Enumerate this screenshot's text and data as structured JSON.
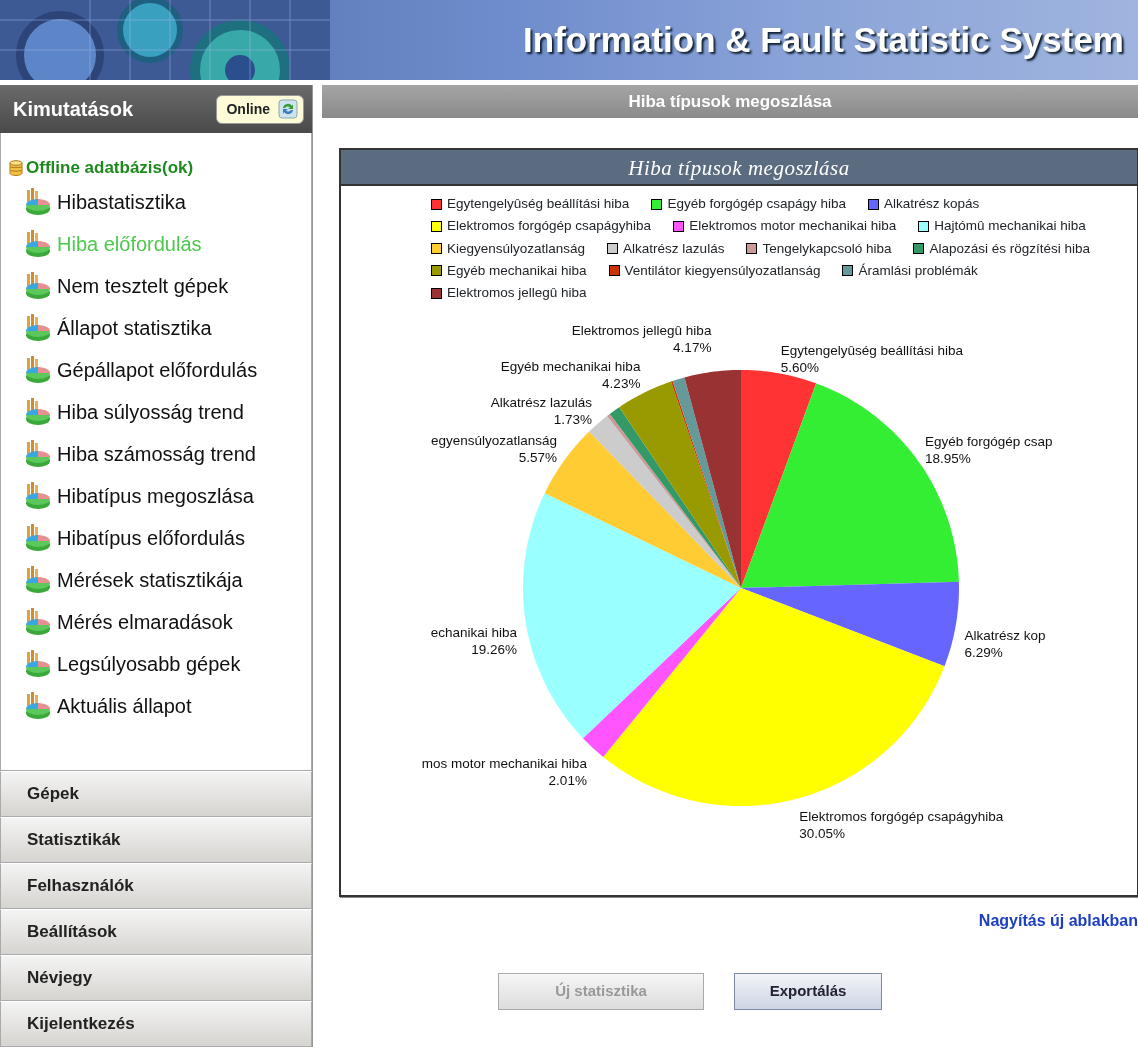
{
  "banner": {
    "title": "Information & Fault Statistic System"
  },
  "sidebar": {
    "title": "Kimutatások",
    "online_button": {
      "label": "Online"
    },
    "tree": [
      {
        "label": "Offline adatbázis(ok)",
        "expanded": true,
        "children": [
          {
            "label": "Hibastatisztika",
            "selected": false
          },
          {
            "label": "Hiba előfordulás",
            "selected": true
          },
          {
            "label": "Nem tesztelt gépek",
            "selected": false
          },
          {
            "label": "Állapot statisztika",
            "selected": false
          },
          {
            "label": "Gépállapot előfordulás",
            "selected": false
          },
          {
            "label": "Hiba súlyosság trend",
            "selected": false
          },
          {
            "label": "Hiba számosság trend",
            "selected": false
          },
          {
            "label": "Hibatípus megoszlása",
            "selected": false
          },
          {
            "label": "Hibatípus előfordulás",
            "selected": false
          },
          {
            "label": "Mérések statisztikája",
            "selected": false
          },
          {
            "label": "Mérés elmaradások",
            "selected": false
          },
          {
            "label": "Legsúlyosabb gépek",
            "selected": false
          },
          {
            "label": "Aktuális állapot",
            "selected": false
          }
        ]
      }
    ],
    "sections": [
      {
        "label": "Gépek"
      },
      {
        "label": "Statisztikák"
      },
      {
        "label": "Felhasználók"
      },
      {
        "label": "Beállítások"
      },
      {
        "label": "Névjegy"
      },
      {
        "label": "Kijelentkezés"
      }
    ]
  },
  "main": {
    "header": "Hiba típusok megoszlása",
    "chart": {
      "chart_data": {
        "type": "pie",
        "title": "Hiba típusok megoszlása",
        "categories": [
          "Egytengelyûség beállítási hiba",
          "Egyéb forgógép csapágy hiba",
          "Alkatrész kopás",
          "Elektromos forgógép csapágyhiba",
          "Elektromos motor mechanikai hiba",
          "Hajtómû mechanikai hiba",
          "Kiegyensúlyozatlanság",
          "Alkatrész lazulás",
          "Tengelykapcsoló hiba",
          "Alapozási és rögzítési hiba",
          "Egyéb mechanikai hiba",
          "Ventilátor kiegyensúlyozatlanság",
          "Áramlási problémák",
          "Elektromos jellegû hiba"
        ],
        "values": [
          5.6,
          18.95,
          6.29,
          30.05,
          2.01,
          19.26,
          5.57,
          1.73,
          0.26,
          0.85,
          4.23,
          0.12,
          0.91,
          4.17
        ],
        "colors": [
          "#ff3333",
          "#33ee33",
          "#6666ff",
          "#ffff00",
          "#ff55ff",
          "#99ffff",
          "#ffcc33",
          "#cccccc",
          "#cc9999",
          "#339966",
          "#999900",
          "#cc3300",
          "#669999",
          "#993333"
        ],
        "data_labels": true,
        "annotations": [
          "Egytengelyûség beállítási hiba",
          "Egyéb forgógép csap",
          "Alkatrész kop",
          "Elektromos forgógép csapágyhiba",
          "mos motor mechanikai hiba",
          "echanikai hiba",
          "egyensúlyozatlanság",
          "Alkatrész lazulás",
          null,
          null,
          "Egyéb mechanikai hiba",
          null,
          null,
          "Elektromos jellegû hiba"
        ],
        "value_labels": [
          "5.60%",
          "18.95%",
          "6.29%",
          "30.05%",
          "2.01%",
          "19.26%",
          "5.57%",
          "1.73%",
          null,
          null,
          "4.23%",
          null,
          null,
          "4.17%"
        ]
      }
    },
    "zoom_link": "Nagyítás új ablakban",
    "buttons": [
      {
        "label": "Új statisztika",
        "disabled": true
      },
      {
        "label": "Exportálás",
        "disabled": false
      }
    ]
  }
}
